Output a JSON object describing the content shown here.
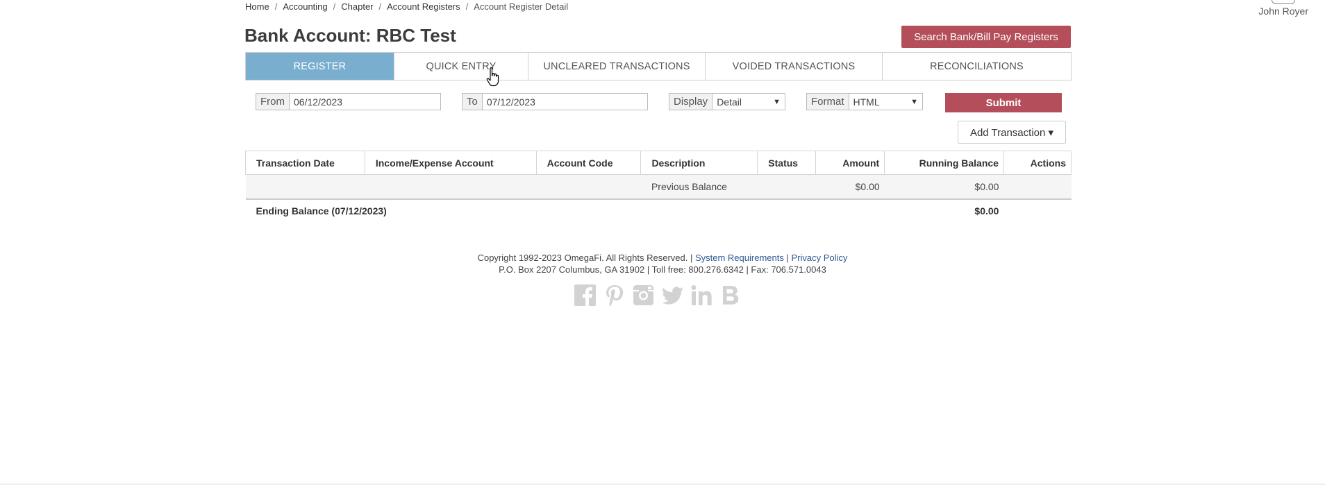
{
  "breadcrumb": [
    "Home",
    "Accounting",
    "Chapter",
    "Account Registers",
    "Account Register Detail"
  ],
  "user": {
    "name": "John Royer"
  },
  "page": {
    "title": "Bank Account: RBC Test"
  },
  "search_button": "Search Bank/Bill Pay Registers",
  "tabs": [
    "REGISTER",
    "QUICK ENTRY",
    "UNCLEARED TRANSACTIONS",
    "VOIDED TRANSACTIONS",
    "RECONCILIATIONS"
  ],
  "filters": {
    "from_label": "From",
    "from_value": "06/12/2023",
    "to_label": "To",
    "to_value": "07/12/2023",
    "display_label": "Display",
    "display_value": "Detail",
    "format_label": "Format",
    "format_value": "HTML"
  },
  "submit_button": "Submit",
  "add_transaction_button": "Add Transaction ▾",
  "table": {
    "headers": [
      "Transaction Date",
      "Income/Expense Account",
      "Account Code",
      "Description",
      "Status",
      "Amount",
      "Running Balance",
      "Actions"
    ],
    "previous_row": {
      "description": "Previous Balance",
      "amount": "$0.00",
      "running_balance": "$0.00"
    },
    "ending_row": {
      "label": "Ending Balance (07/12/2023)",
      "running_balance": "$0.00"
    }
  },
  "footer": {
    "copyright": "Copyright 1992-2023 OmegaFi. All Rights Reserved. |",
    "system_requirements": "System Requirements",
    "sep": "|",
    "privacy": "Privacy Policy",
    "address": "P.O. Box 2207 Columbus, GA 31902 | Toll free: 800.276.6342 | Fax: 706.571.0043"
  },
  "social_icons": [
    "facebook-icon",
    "pinterest-icon",
    "instagram-icon",
    "twitter-icon",
    "linkedin-icon",
    "b-icon"
  ],
  "colors": {
    "accent": "#b34e5a",
    "active_tab": "#7aaecf",
    "link": "#2d5894",
    "social": "#d2d2d2"
  }
}
